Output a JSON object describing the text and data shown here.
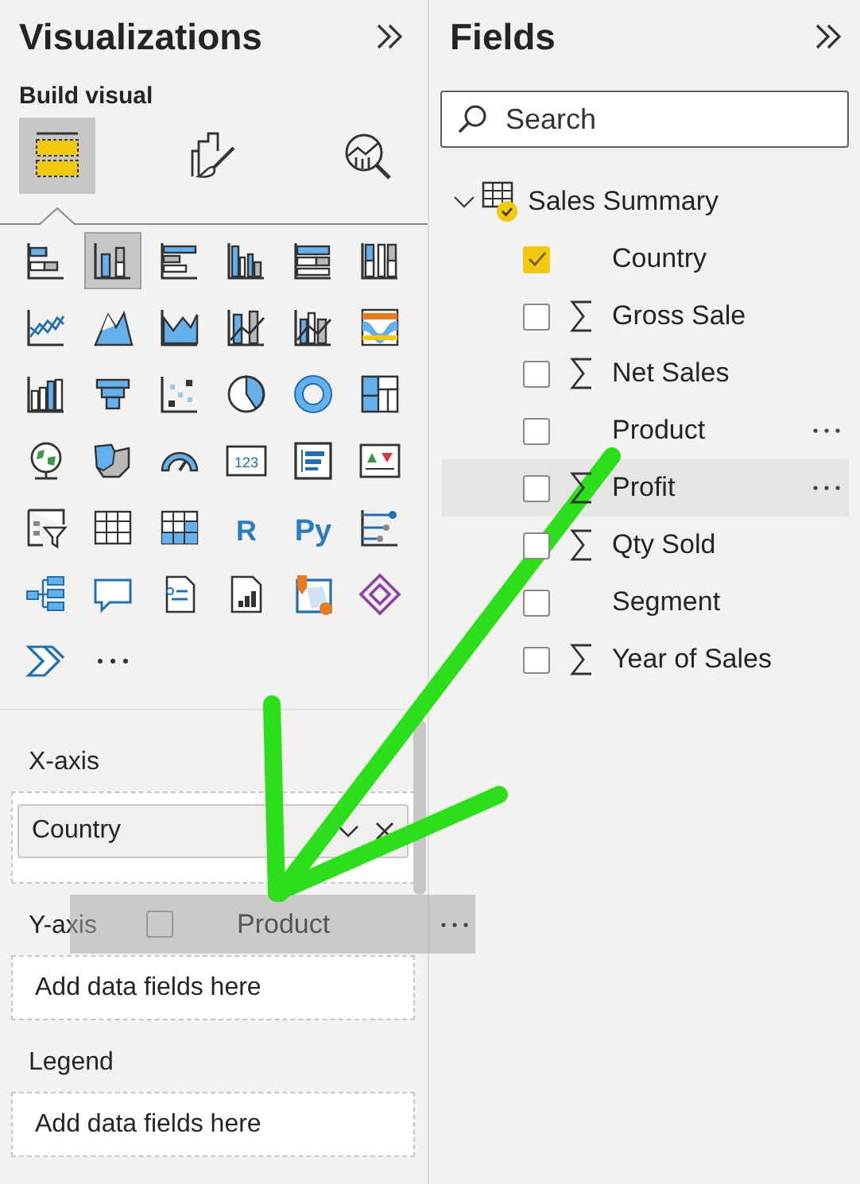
{
  "visualizations": {
    "title": "Visualizations",
    "build_visual": {
      "label": "Build visual",
      "tabs": [
        {
          "kind": "fields",
          "selected": true
        },
        {
          "kind": "format",
          "selected": false
        },
        {
          "kind": "analytics",
          "selected": false
        }
      ]
    },
    "visual_types": [
      {
        "kind": "stacked-bar",
        "selected": false
      },
      {
        "kind": "stacked-column",
        "selected": true
      },
      {
        "kind": "clustered-bar",
        "selected": false
      },
      {
        "kind": "clustered-column",
        "selected": false
      },
      {
        "kind": "percent-bar",
        "selected": false
      },
      {
        "kind": "percent-column",
        "selected": false
      },
      {
        "kind": "line",
        "selected": false
      },
      {
        "kind": "area",
        "selected": false
      },
      {
        "kind": "stacked-area",
        "selected": false
      },
      {
        "kind": "line-column",
        "selected": false
      },
      {
        "kind": "line-clustered",
        "selected": false
      },
      {
        "kind": "ribbon",
        "selected": false
      },
      {
        "kind": "waterfall",
        "selected": false
      },
      {
        "kind": "funnel",
        "selected": false
      },
      {
        "kind": "scatter",
        "selected": false
      },
      {
        "kind": "pie",
        "selected": false
      },
      {
        "kind": "donut",
        "selected": false
      },
      {
        "kind": "treemap",
        "selected": false
      },
      {
        "kind": "globe",
        "selected": false
      },
      {
        "kind": "filled-map",
        "selected": false
      },
      {
        "kind": "gauge",
        "selected": false
      },
      {
        "kind": "card",
        "label": "123",
        "selected": false
      },
      {
        "kind": "multi-card",
        "selected": false
      },
      {
        "kind": "kpi",
        "selected": false
      },
      {
        "kind": "slicer",
        "selected": false
      },
      {
        "kind": "table",
        "selected": false
      },
      {
        "kind": "matrix",
        "selected": false
      },
      {
        "kind": "letter",
        "label": "R",
        "selected": false
      },
      {
        "kind": "letter",
        "label": "Py",
        "selected": false
      },
      {
        "kind": "influencers",
        "selected": false
      },
      {
        "kind": "decomposition",
        "selected": false
      },
      {
        "kind": "speech",
        "selected": false
      },
      {
        "kind": "narrative",
        "selected": false
      },
      {
        "kind": "report",
        "selected": false
      },
      {
        "kind": "map-pin",
        "selected": false
      },
      {
        "kind": "diamond",
        "selected": false
      },
      {
        "kind": "automate",
        "selected": false
      },
      {
        "kind": "more",
        "selected": false
      }
    ],
    "wells": [
      {
        "label": "X-axis",
        "fields": [
          "Country"
        ]
      },
      {
        "label": "Y-axis",
        "placeholder": "Add data fields here"
      },
      {
        "label": "Legend",
        "placeholder": "Add data fields here"
      }
    ]
  },
  "fields": {
    "title": "Fields",
    "search": {
      "placeholder": "Search"
    },
    "table": {
      "name": "Sales Summary",
      "expanded": true,
      "in_use": true,
      "children": [
        {
          "name": "Country",
          "kind": "text",
          "checked": true,
          "highlighted": false,
          "menu": false
        },
        {
          "name": "Gross Sale",
          "kind": "sum",
          "checked": false,
          "highlighted": false,
          "menu": false
        },
        {
          "name": "Net Sales",
          "kind": "sum",
          "checked": false,
          "highlighted": false,
          "menu": false
        },
        {
          "name": "Product",
          "kind": "text",
          "checked": false,
          "highlighted": false,
          "menu": true
        },
        {
          "name": "Profit",
          "kind": "sum",
          "checked": false,
          "highlighted": true,
          "menu": true
        },
        {
          "name": "Qty Sold",
          "kind": "sum",
          "checked": false,
          "highlighted": false,
          "menu": false
        },
        {
          "name": "Segment",
          "kind": "text",
          "checked": false,
          "highlighted": false,
          "menu": false
        },
        {
          "name": "Year of Sales",
          "kind": "sum",
          "checked": false,
          "highlighted": false,
          "menu": false
        }
      ]
    }
  },
  "drag_ghost": {
    "label": "Product",
    "checked": false
  }
}
